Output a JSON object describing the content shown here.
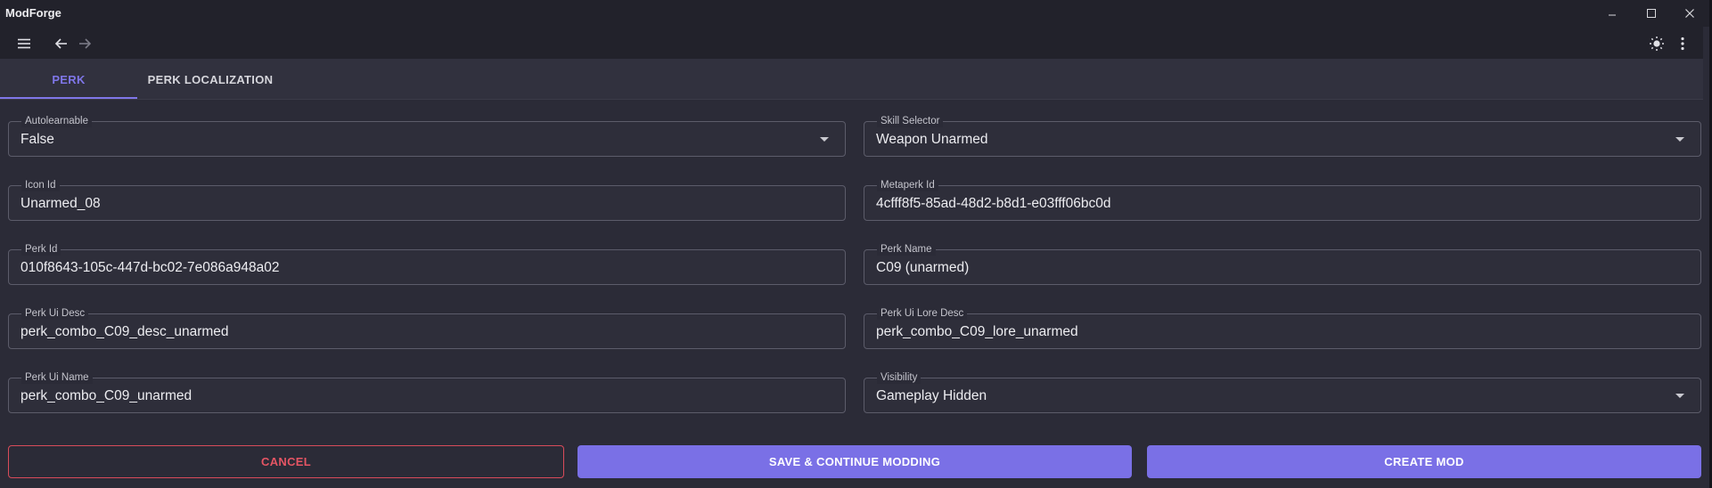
{
  "app": {
    "title": "ModForge"
  },
  "window_controls": [
    {
      "name": "minimize",
      "icon": "minimize-icon"
    },
    {
      "name": "maximize",
      "icon": "maximize-icon"
    },
    {
      "name": "close",
      "icon": "close-icon"
    }
  ],
  "toolbar": {
    "icons": [
      "menu-icon",
      "back-arrow-icon",
      "forward-arrow-icon",
      "theme-toggle-sun-icon",
      "more-vertical-icon"
    ]
  },
  "tabs": [
    {
      "label": "PERK",
      "active": true
    },
    {
      "label": "PERK LOCALIZATION",
      "active": false
    }
  ],
  "form": {
    "autolearnable": {
      "label": "Autolearnable",
      "value": "False",
      "type": "select"
    },
    "skill_selector": {
      "label": "Skill Selector",
      "value": "Weapon Unarmed",
      "type": "select"
    },
    "icon_id": {
      "label": "Icon Id",
      "value": "Unarmed_08",
      "type": "text"
    },
    "metaperk_id": {
      "label": "Metaperk Id",
      "value": "4cfff8f5-85ad-48d2-b8d1-e03fff06bc0d",
      "type": "text"
    },
    "perk_id": {
      "label": "Perk Id",
      "value": "010f8643-105c-447d-bc02-7e086a948a02",
      "type": "text"
    },
    "perk_name": {
      "label": "Perk Name",
      "value": "C09 (unarmed)",
      "type": "text"
    },
    "perk_ui_desc": {
      "label": "Perk Ui Desc",
      "value": "perk_combo_C09_desc_unarmed",
      "type": "text"
    },
    "perk_ui_lore_desc": {
      "label": "Perk Ui Lore Desc",
      "value": "perk_combo_C09_lore_unarmed",
      "type": "text"
    },
    "perk_ui_name": {
      "label": "Perk Ui Name",
      "value": "perk_combo_C09_unarmed",
      "type": "text"
    },
    "visibility": {
      "label": "Visibility",
      "value": "Gameplay Hidden",
      "type": "select"
    }
  },
  "actions": {
    "cancel": "CANCEL",
    "save_continue": "SAVE & CONTINUE MODDING",
    "create_mod": "CREATE MOD"
  },
  "colors": {
    "accent": "#7a70e6",
    "danger": "#e55564",
    "background": "#2b2b37",
    "titlebar": "#22222b"
  }
}
